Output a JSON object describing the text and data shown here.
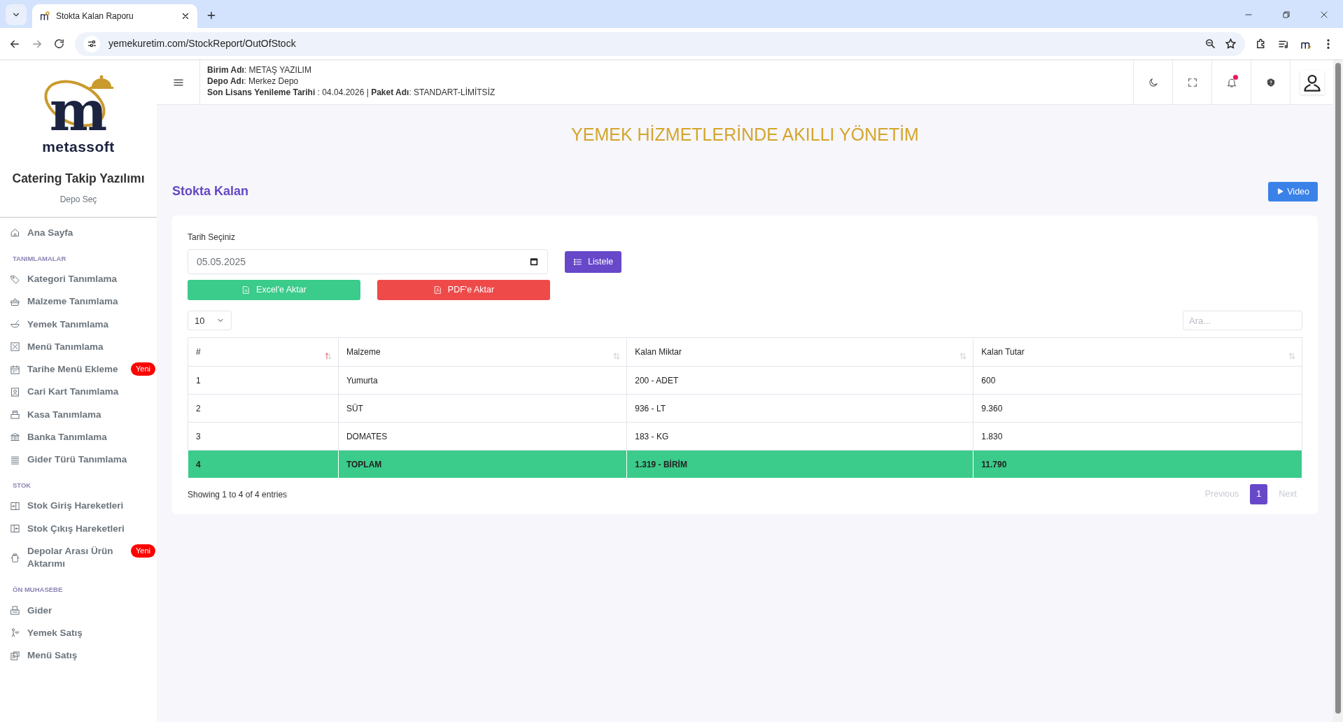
{
  "browser": {
    "tabs": [
      {
        "title": "Stokta Kalan Raporu",
        "selected": true
      }
    ],
    "url": "yemekuretim.com/StockReport/OutOfStock"
  },
  "header": {
    "info_lines": [
      "**Birim Adı**: METAŞ YAZILIM",
      "**Depo Adı**: Merkez Depo",
      "**Son Lisans Yenileme Tarihi** : 04.04.2026 | **Paket Adı**: STANDART-LİMİTSİZ"
    ],
    "notification_unread": true
  },
  "sidebar": {
    "logo_mark": "m",
    "logo_text": "metassoft",
    "app_title": "Catering Takip Yazılımı",
    "depot_link": "Depo Seç",
    "sections": [
      {
        "items": [
          {
            "label": "Ana Sayfa"
          }
        ]
      },
      {
        "heading": "TANIMLAMALAR",
        "items": [
          {
            "label": "Kategori Tanımlama"
          },
          {
            "label": "Malzeme Tanımlama"
          },
          {
            "label": "Yemek Tanımlama"
          },
          {
            "label": "Menü Tanımlama"
          },
          {
            "label": "Tarihe Menü Ekleme",
            "badge": "Yeni"
          },
          {
            "label": "Cari Kart Tanımlama"
          },
          {
            "label": "Kasa Tanımlama"
          },
          {
            "label": "Banka Tanımlama"
          },
          {
            "label": "Gider Türü Tanımlama"
          }
        ]
      },
      {
        "heading": "STOK",
        "items": [
          {
            "label": "Stok Giriş Hareketleri"
          },
          {
            "label": "Stok Çıkış Hareketleri"
          },
          {
            "label": "Depolar Arası Ürün Aktarımı",
            "badge": "Yeni"
          }
        ]
      },
      {
        "heading": "ÖN MUHASEBE",
        "items": [
          {
            "label": "Gider"
          },
          {
            "label": "Yemek Satış"
          },
          {
            "label": "Menü Satış"
          }
        ]
      }
    ]
  },
  "page": {
    "banner": "YEMEK HİZMETLERİNDE AKILLI YÖNETİM",
    "title": "Stokta Kalan",
    "video_button": "Video",
    "form": {
      "date_label": "Tarih Seçiniz",
      "date_value": "05.05.2025",
      "list_button": "Listele",
      "excel_button": "Excel'e Aktar",
      "pdf_button": "PDF'e Aktar"
    },
    "table": {
      "page_size": "10",
      "search_placeholder": "Ara...",
      "columns": [
        {
          "label": "#",
          "sorted_ascending": true
        },
        {
          "label": "Malzeme",
          "sorted_ascending": false
        },
        {
          "label": "Kalan Miktar",
          "sorted_ascending": false
        },
        {
          "label": "Kalan Tutar",
          "sorted_ascending": false
        }
      ],
      "rows": [
        {
          "kind": "item",
          "cells": [
            "1",
            "Yumurta",
            "200 - ADET",
            "600"
          ]
        },
        {
          "kind": "item",
          "cells": [
            "2",
            "SÜT",
            "936 - LT",
            "9.360"
          ]
        },
        {
          "kind": "item",
          "cells": [
            "3",
            "DOMATES",
            "183 - KG",
            "1.830"
          ]
        },
        {
          "kind": "total",
          "cells": [
            "4",
            "TOPLAM",
            "1.319 - BİRİM",
            "11.790"
          ]
        }
      ],
      "info": "Showing 1 to 4 of 4 entries",
      "pagination": {
        "previous": {
          "label": "Previous",
          "disabled": true
        },
        "pages": [
          {
            "label": "1",
            "selected": true
          }
        ],
        "next": {
          "label": "Next",
          "disabled": true
        }
      }
    }
  }
}
